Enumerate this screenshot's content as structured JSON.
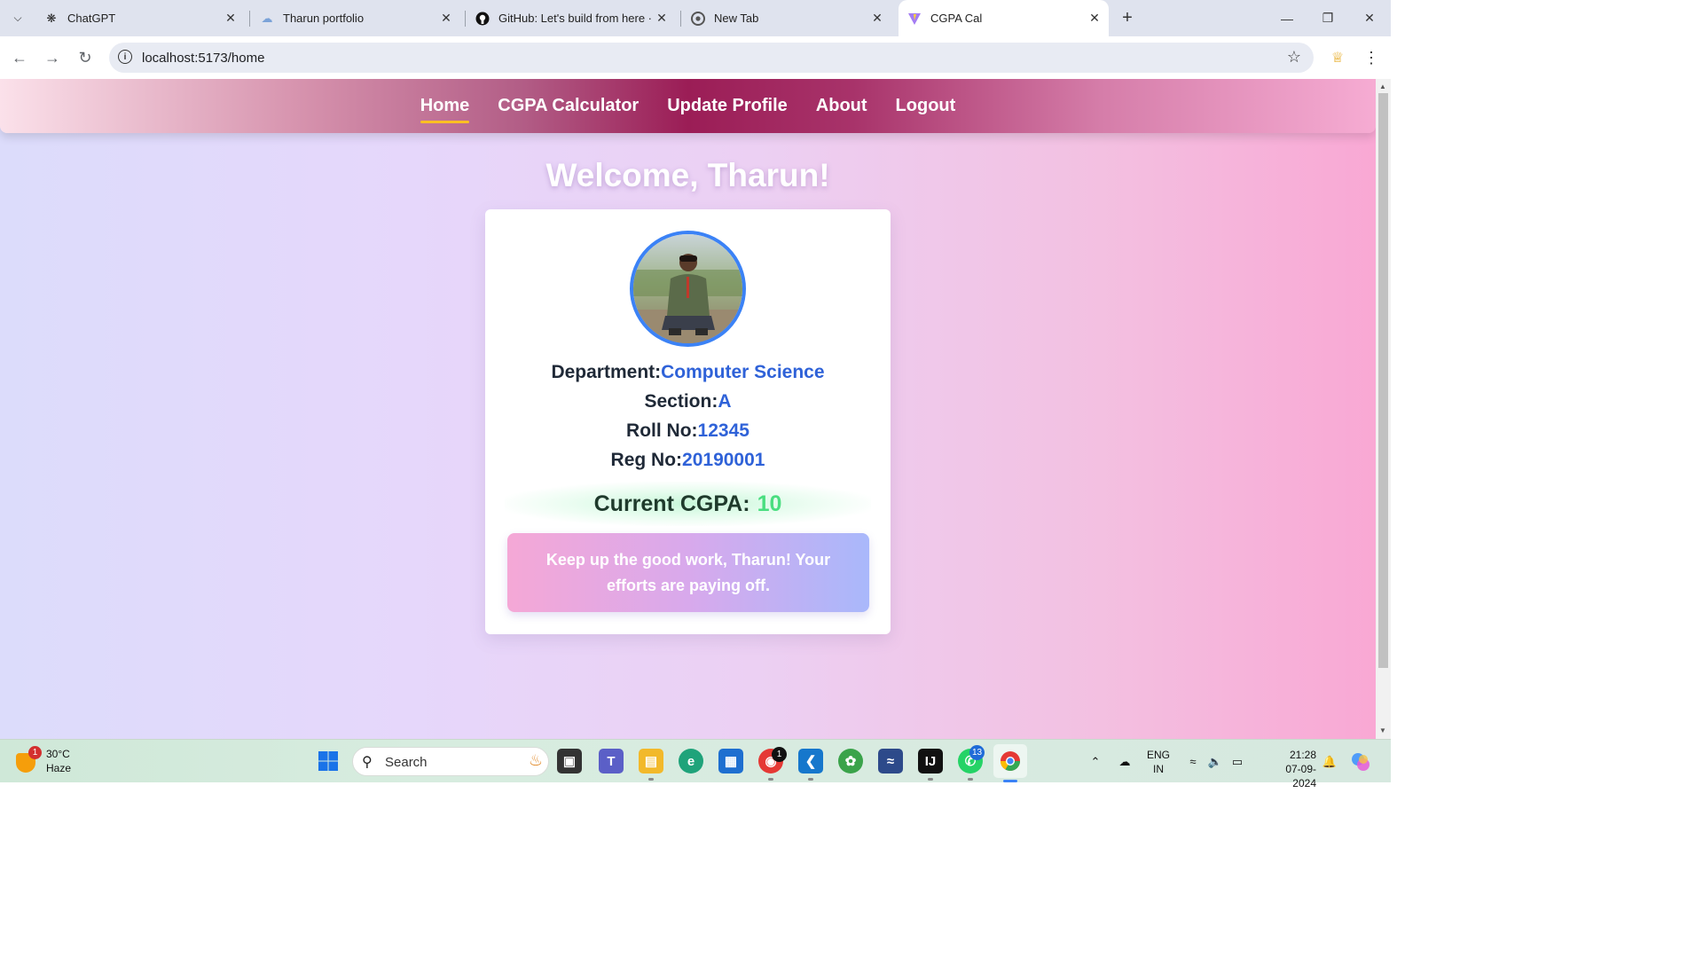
{
  "browser": {
    "tabs": [
      {
        "title": "ChatGPT",
        "icon": "chatgpt-icon"
      },
      {
        "title": "Tharun portfolio",
        "icon": "portfolio-icon"
      },
      {
        "title": "GitHub: Let's build from here · G",
        "icon": "github-icon"
      },
      {
        "title": "New Tab",
        "icon": "chrome-icon"
      },
      {
        "title": "CGPA Cal",
        "icon": "vite-icon",
        "active": true
      }
    ],
    "url": "localhost:5173/home"
  },
  "nav": {
    "links": [
      "Home",
      "CGPA Calculator",
      "Update Profile",
      "About",
      "Logout"
    ],
    "active": "Home"
  },
  "page": {
    "welcome": "Welcome, Tharun!",
    "department_label": "Department:",
    "department": "Computer Science",
    "section_label": "Section:",
    "section": "A",
    "roll_label": "Roll No:",
    "roll": "12345",
    "reg_label": "Reg No:",
    "reg": "20190001",
    "cgpa_label": "Current CGPA:",
    "cgpa": "10",
    "message": "Keep up the good work, Tharun! Your efforts are paying off."
  },
  "taskbar": {
    "weather_temp": "30°C",
    "weather_cond": "Haze",
    "weather_badge": "1",
    "search_placeholder": "Search",
    "chrome_badge": "1",
    "whatsapp_badge": "13",
    "lang_1": "ENG",
    "lang_2": "IN",
    "time": "21:28",
    "date": "07-09-2024"
  },
  "colors": {
    "accent_blue": "#2f62d8",
    "cgpa_green": "#4ade80",
    "nav_dark": "#9b1d56",
    "nav_underline": "#fbbf24"
  }
}
